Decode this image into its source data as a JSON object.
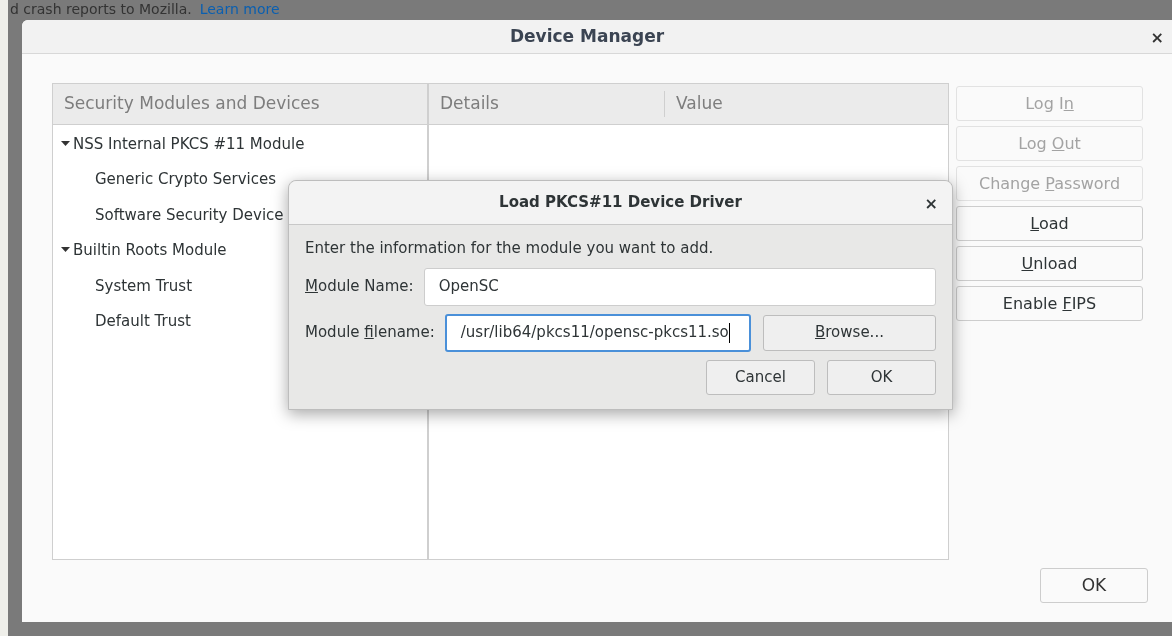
{
  "background_page": {
    "top_line": {
      "text": "d crash reports to Mozilla.",
      "link": "Learn more"
    }
  },
  "window": {
    "title": "Device Manager",
    "close": "×",
    "tree": {
      "columns": [
        "Security Modules and Devices"
      ],
      "items": [
        {
          "label": "NSS Internal PKCS #11 Module",
          "expanded": true,
          "children": [
            {
              "label": "Generic Crypto Services"
            },
            {
              "label": "Software Security Device"
            }
          ]
        },
        {
          "label": "Builtin Roots Module",
          "expanded": true,
          "children": [
            {
              "label": "System Trust"
            },
            {
              "label": "Default Trust"
            }
          ]
        }
      ]
    },
    "details": {
      "columns": [
        "Details",
        "Value"
      ]
    },
    "buttons": [
      {
        "before": "Log I",
        "key": "n",
        "disabled": true
      },
      {
        "before": "Log ",
        "key": "O",
        "after": "ut",
        "disabled": true
      },
      {
        "before": "Change ",
        "key": "P",
        "after": "assword",
        "disabled": true
      },
      {
        "key": "L",
        "after": "oad",
        "disabled": false
      },
      {
        "key": "U",
        "after": "nload",
        "disabled": false
      },
      {
        "before": "Enable ",
        "key": "F",
        "after": "IPS",
        "disabled": false
      }
    ],
    "ok": "OK"
  },
  "dialog": {
    "title": "Load PKCS#11 Device Driver",
    "close": "×",
    "intro": "Enter the information for the module you want to add.",
    "fields": [
      {
        "label": {
          "key": "M",
          "after": "odule Name:"
        },
        "value": "OpenSC",
        "focused": false
      },
      {
        "label": {
          "before": "Module ",
          "key": "f",
          "after": "ilename:"
        },
        "value": "/usr/lib64/pkcs11/opensc-pkcs11.so",
        "focused": true,
        "button": {
          "key": "B",
          "after": "rowse..."
        }
      }
    ],
    "buttons": [
      "Cancel",
      "OK"
    ]
  }
}
